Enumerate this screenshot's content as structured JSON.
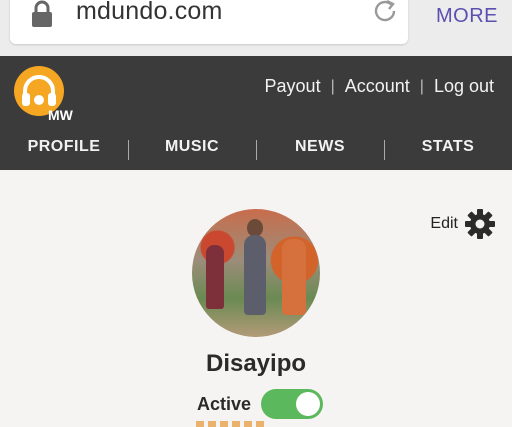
{
  "browser": {
    "url": "mdundo.com",
    "more_label": "MORE"
  },
  "header": {
    "logo_text": "MW",
    "links": [
      {
        "label": "Payout"
      },
      {
        "label": "Account"
      },
      {
        "label": "Log out"
      }
    ],
    "nav": [
      {
        "label": "PROFILE"
      },
      {
        "label": "MUSIC"
      },
      {
        "label": "NEWS"
      },
      {
        "label": "STATS"
      }
    ]
  },
  "profile": {
    "edit_label": "Edit",
    "username": "Disayipo",
    "status_label": "Active",
    "active": true
  },
  "colors": {
    "header_bg": "#3b3b3b",
    "logo_orange": "#f5a623",
    "toggle_green": "#5cb85c",
    "more_purple": "#5b4fb0"
  }
}
